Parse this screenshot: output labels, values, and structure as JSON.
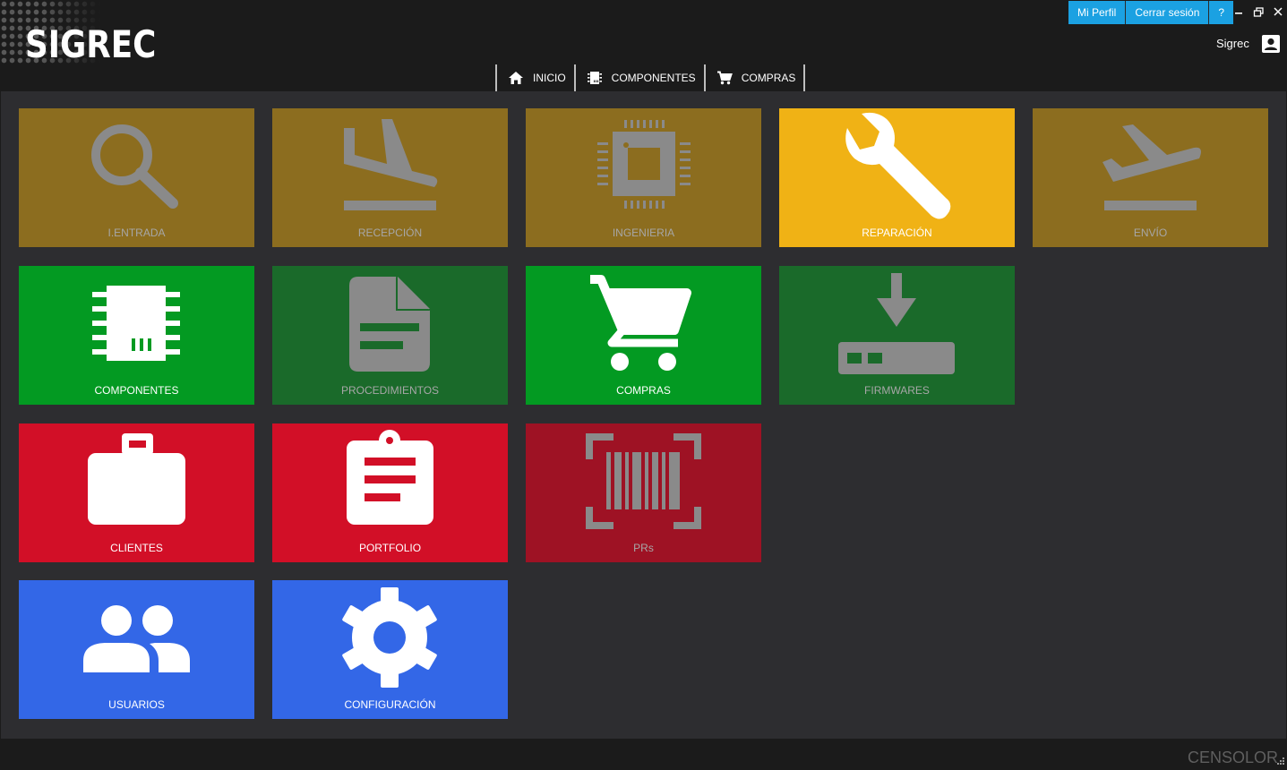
{
  "app": {
    "logo_text": "SIGREC",
    "brand_footer": "CENSOLOR"
  },
  "header": {
    "actions": [
      {
        "label": "Mi Perfil"
      },
      {
        "label": "Cerrar sesión"
      },
      {
        "label": "?"
      }
    ],
    "window_controls": {
      "minimize": "–",
      "restore": "⧉",
      "close": "✕"
    },
    "user": {
      "name": "Sigrec",
      "icon": "account-box-icon"
    }
  },
  "nav": {
    "items": [
      {
        "label": "INICIO",
        "icon": "home-icon"
      },
      {
        "label": "COMPONENTES",
        "icon": "chip-icon"
      },
      {
        "label": "COMPRAS",
        "icon": "cart-icon"
      }
    ]
  },
  "colors": {
    "gold_dim": "#8c6d1f",
    "gold_active": "#f0b215",
    "green": "#039a22",
    "green_dim": "#1a6a2a",
    "red": "#d20f27",
    "red_dim": "#9e1224",
    "blue": "#3367e7",
    "accent": "#1ba1e2"
  },
  "tiles": [
    {
      "label": "I.ENTRADA",
      "icon": "search-icon",
      "enabled": false
    },
    {
      "label": "RECEPCIÓN",
      "icon": "flight-land-icon",
      "enabled": false
    },
    {
      "label": "INGENIERIA",
      "icon": "processor-chip-icon",
      "enabled": false
    },
    {
      "label": "REPARACIÓN",
      "icon": "wrench-icon",
      "enabled": true
    },
    {
      "label": "ENVÍO",
      "icon": "flight-takeoff-icon",
      "enabled": false
    },
    {
      "label": "COMPONENTES",
      "icon": "memory-chip-icon",
      "enabled": true
    },
    {
      "label": "PROCEDIMIENTOS",
      "icon": "document-icon",
      "enabled": false
    },
    {
      "label": "COMPRAS",
      "icon": "shopping-cart-icon",
      "enabled": true
    },
    {
      "label": "FIRMWARES",
      "icon": "download-device-icon",
      "enabled": false
    },
    {
      "label": "CLIENTES",
      "icon": "briefcase-icon",
      "enabled": true
    },
    {
      "label": "PORTFOLIO",
      "icon": "clipboard-icon",
      "enabled": true
    },
    {
      "label": "PRs",
      "icon": "barcode-scan-icon",
      "enabled": false
    },
    {
      "label": "USUARIOS",
      "icon": "users-icon",
      "enabled": true
    },
    {
      "label": "CONFIGURACIÓN",
      "icon": "gear-icon",
      "enabled": true
    }
  ]
}
